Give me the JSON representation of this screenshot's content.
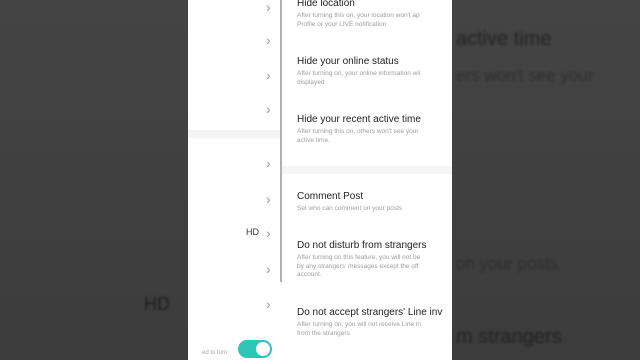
{
  "background": {
    "right_texts": [
      "active time",
      "ers won't see your",
      "on your posts",
      "m strangers"
    ],
    "left_hd": "HD"
  },
  "left_pane": {
    "hd_label": "HD",
    "toggle_note": "ed to turn"
  },
  "settings": [
    {
      "title": "Hide location",
      "desc": [
        "After turning this on, your location won't ap",
        "Profile or your LIVE notification"
      ]
    },
    {
      "title": "Hide your online status",
      "desc": [
        "After turning on, your online information wil",
        "displayed"
      ]
    },
    {
      "title": "Hide your recent active time",
      "desc": [
        "After turning this on, others won't see your",
        "active time."
      ]
    },
    {
      "title": "Comment Post",
      "desc": [
        "Set who can comment on your posts",
        ""
      ]
    },
    {
      "title": "Do not disturb from strangers",
      "desc": [
        "After turning on this feature, you will not be",
        "by any strangers' messages except the off",
        "account."
      ]
    },
    {
      "title": "Do not accept strangers' Line inv",
      "desc": [
        "After turning on, you will not receive Line in",
        "from the strangers"
      ]
    }
  ],
  "colors": {
    "toggle_on": "#2ec4b6"
  }
}
